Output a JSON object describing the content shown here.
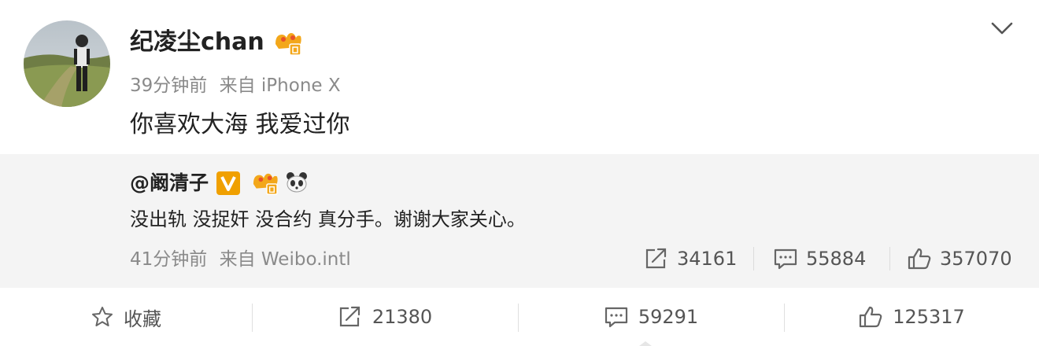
{
  "post": {
    "username": "纪凌尘chan",
    "time": "39分钟前",
    "source": "来自 iPhone X",
    "text": "你喜欢大海 我爱过你"
  },
  "repost": {
    "username": "@阚清子",
    "text": "没出轨 没捉奸 没合约 真分手。谢谢大家关心。",
    "time": "41分钟前",
    "source": "来自 Weibo.intl",
    "reposts": "34161",
    "comments": "55884",
    "likes": "357070"
  },
  "actions": {
    "favorite_label": "收藏",
    "reposts": "21380",
    "comments": "59291",
    "likes": "125317"
  },
  "colors": {
    "badge_gold": "#f0a000",
    "repost_background": "#f4f4f4",
    "meta_text": "#8a8a8a"
  }
}
